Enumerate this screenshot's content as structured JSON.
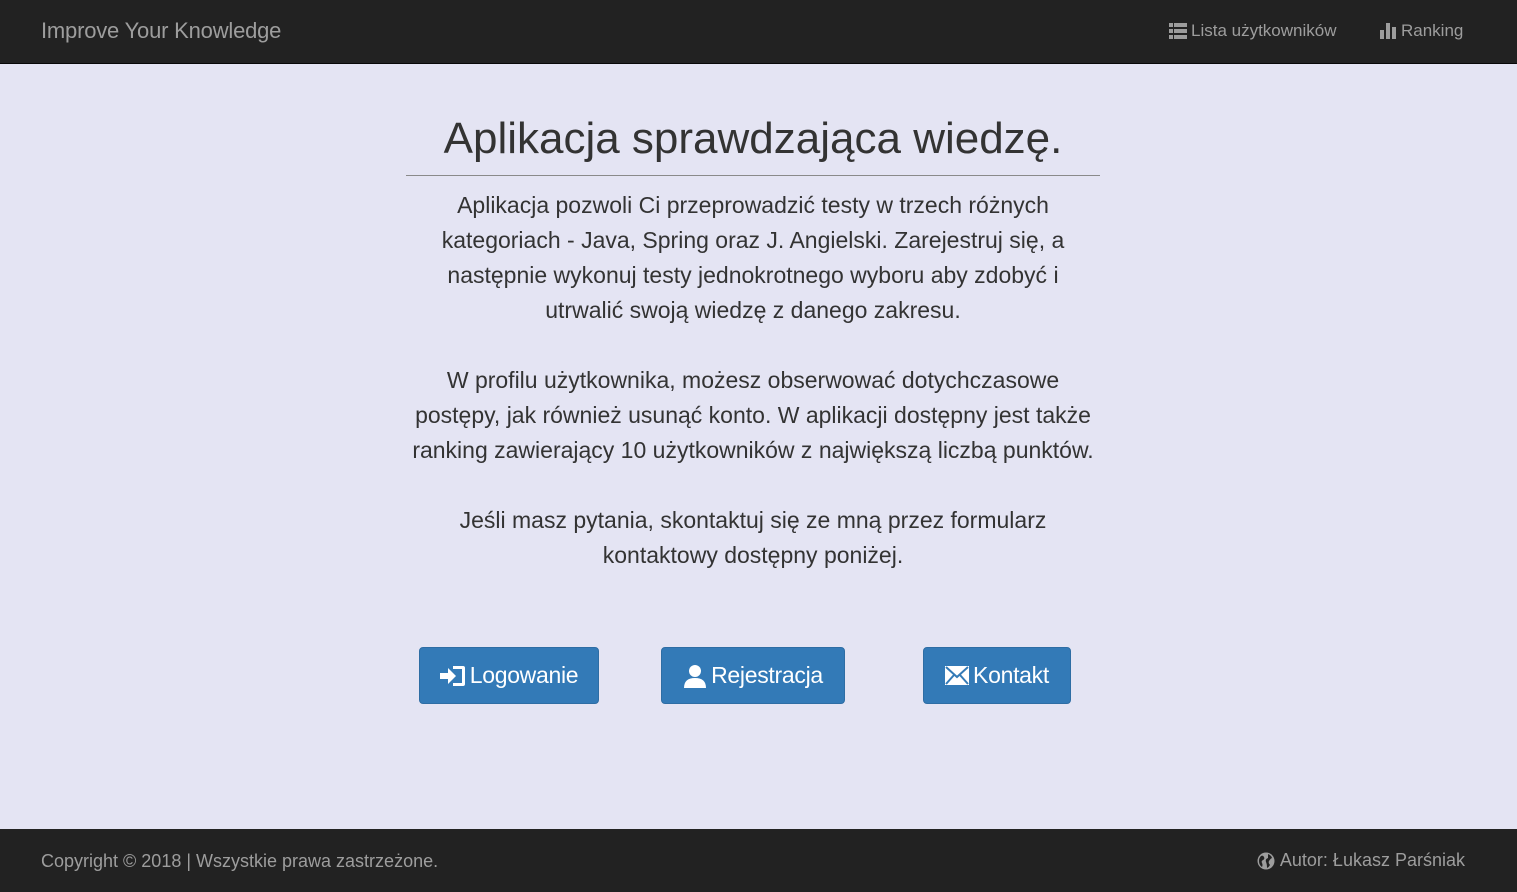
{
  "navbar": {
    "brand": "Improve Your Knowledge",
    "users_link": "Lista użytkowników",
    "ranking_link": "Ranking",
    "background": "#222222",
    "link_color": "#9d9d9d"
  },
  "main": {
    "title": "Aplikacja sprawdzająca wiedzę.",
    "paragraphs": [
      "Aplikacja pozwoli Ci przeprowadzić testy w trzech różnych kategoriach - Java, Spring oraz J. Angielski. Zarejestruj się, a następnie wykonuj testy jednokrotnego wyboru aby zdobyć i utrwalić swoją wiedzę z danego zakresu.",
      "W profilu użytkownika, możesz obserwować dotychczasowe postępy, jak również usunąć konto. W aplikacji dostępny jest także ranking zawierający 10 użytkowników z największą liczbą punktów.",
      "Jeśli masz pytania, skontaktuj się ze mną przez formularz kontaktowy dostępny poniżej."
    ],
    "background": "#e4e4f3"
  },
  "buttons": {
    "login": {
      "label": "Logowanie",
      "icon": "log-in-icon"
    },
    "register": {
      "label": "Rejestracja",
      "icon": "user-icon"
    },
    "contact": {
      "label": "Kontakt",
      "icon": "envelope-icon"
    },
    "color": "#337ab7"
  },
  "footer": {
    "copyright": "Copyright © 2018 | Wszystkie prawa zastrzeżone.",
    "author": "Autor: Łukasz Parśniak",
    "author_icon": "globe-icon"
  }
}
